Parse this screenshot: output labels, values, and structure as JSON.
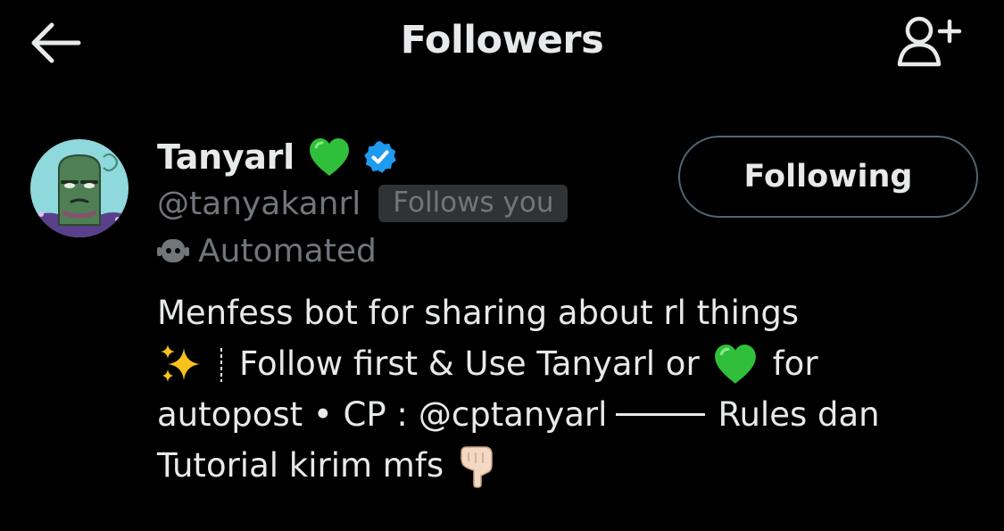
{
  "header": {
    "title": "Followers",
    "back_icon": "arrow-left-icon",
    "add_user_icon": "person-plus-icon"
  },
  "follower": {
    "display_name": "Tanyarl",
    "name_emoji": "green-heart-icon",
    "verified_icon": "verified-badge-icon",
    "handle": "@tanyakanrl",
    "follows_you": "Follows you",
    "automated_label": "Automated",
    "follow_button_label": "Following",
    "bio": {
      "line1": "Menfess bot for sharing about rl things",
      "line2_part1": "Follow first & Use Tanyarl or",
      "line2_part2": "for",
      "line3_part1": "autopost • CP :",
      "line3_mention": "@cptanyarl",
      "line3_part2": "Rules dan",
      "line4": "Tutorial kirim mfs"
    }
  },
  "colors": {
    "background": "#000000",
    "primary_text": "#e7e9ea",
    "secondary_text": "#71767b",
    "badge_bg": "#2f3336",
    "verified_blue": "#1d9bf0",
    "heart_green": "#2fbf3a",
    "button_border": "#536471"
  }
}
